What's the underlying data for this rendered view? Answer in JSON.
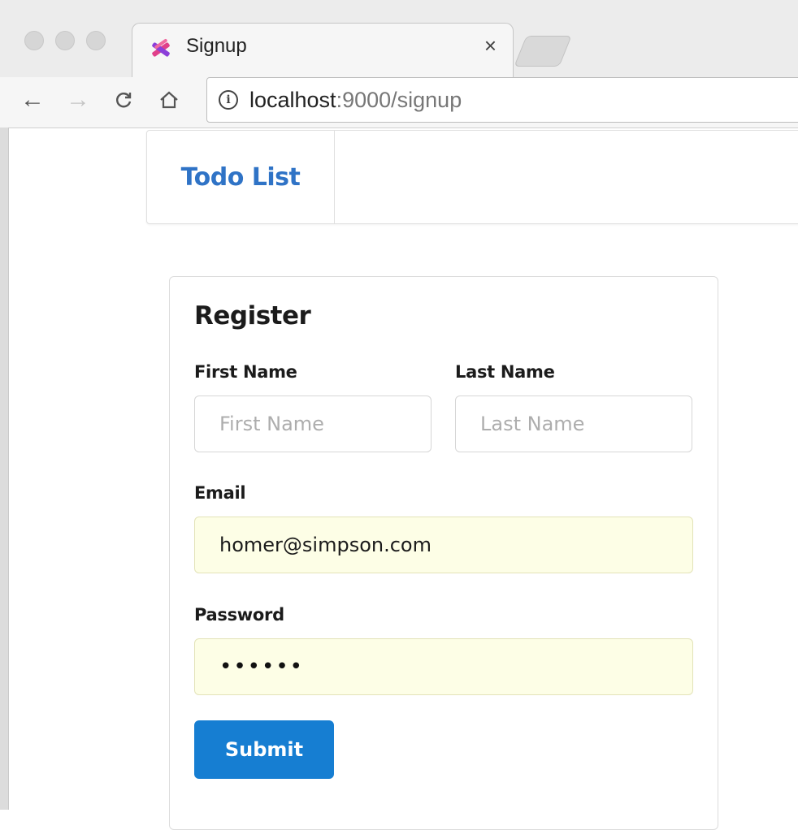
{
  "browser": {
    "tab_title": "Signup",
    "tab_close": "×",
    "url_host": "localhost",
    "url_path": ":9000/signup"
  },
  "navbar": {
    "brand": "Todo List"
  },
  "form": {
    "title": "Register",
    "first_name": {
      "label": "First Name",
      "value": "",
      "placeholder": "First Name"
    },
    "last_name": {
      "label": "Last Name",
      "value": "",
      "placeholder": "Last Name"
    },
    "email": {
      "label": "Email",
      "value": "homer@simpson.com"
    },
    "password": {
      "label": "Password",
      "masked_value": "••••••"
    },
    "submit_label": "Submit"
  },
  "colors": {
    "brand": "#2f73c6",
    "submit": "#167ed2",
    "autofill_bg": "#fdfee6"
  }
}
